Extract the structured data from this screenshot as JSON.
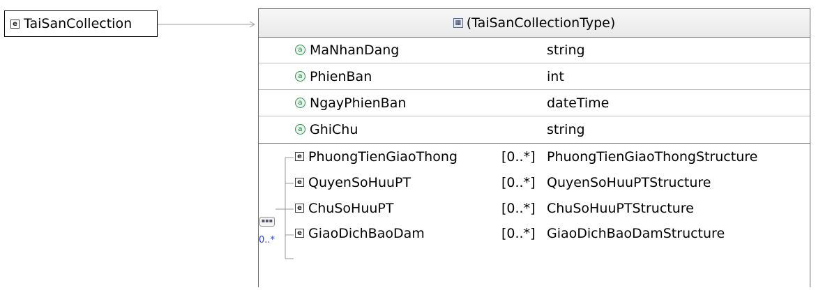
{
  "root": {
    "name": "TaiSanCollection",
    "icon": "element-icon"
  },
  "complex_type": {
    "title": "(TaiSanCollectionType)",
    "icon": "complex-type-icon",
    "attributes": [
      {
        "name": "MaNhanDang",
        "type": "string"
      },
      {
        "name": "PhienBan",
        "type": "int"
      },
      {
        "name": "NgayPhienBan",
        "type": "dateTime"
      },
      {
        "name": "GhiChu",
        "type": "string"
      }
    ],
    "sequence": {
      "icon": "sequence-icon",
      "multiplicity": "0..*"
    },
    "children": [
      {
        "name": "PhuongTienGiaoThong",
        "multiplicity": "[0..*]",
        "type": "PhuongTienGiaoThongStructure"
      },
      {
        "name": "QuyenSoHuuPT",
        "multiplicity": "[0..*]",
        "type": "QuyenSoHuuPTStructure"
      },
      {
        "name": "ChuSoHuuPT",
        "multiplicity": "[0..*]",
        "type": "ChuSoHuuPTStructure"
      },
      {
        "name": "GiaoDichBaoDam",
        "multiplicity": "[0..*]",
        "type": "GiaoDichBaoDamStructure"
      }
    ]
  },
  "colors": {
    "attribute_icon": "#2e8b57",
    "multiplicity_text": "#1f3fcf",
    "border": "#6a6a6a"
  }
}
